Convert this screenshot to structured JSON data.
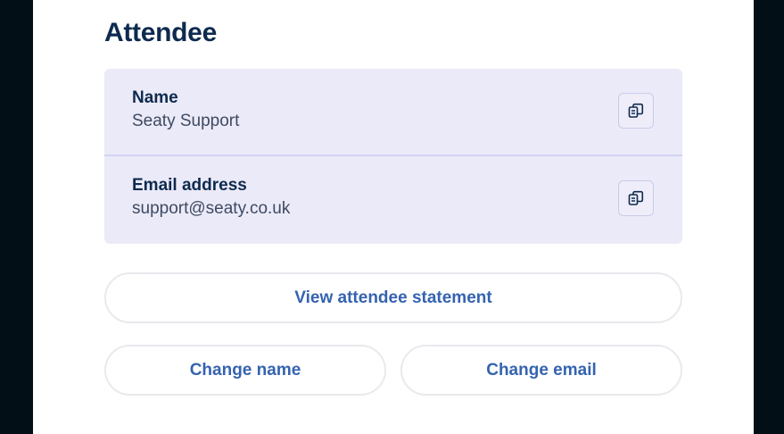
{
  "section": {
    "title": "Attendee"
  },
  "attendee": {
    "name_label": "Name",
    "name_value": "Seaty Support",
    "email_label": "Email address",
    "email_value": "support@seaty.co.uk"
  },
  "actions": {
    "view_statement": "View attendee statement",
    "change_name": "Change name",
    "change_email": "Change email"
  },
  "icons": {
    "copy": "copy-icon"
  },
  "colors": {
    "background": "#020f17",
    "heading": "#0e2a4f",
    "card": "#ebeaf8",
    "button_text": "#3563b0"
  }
}
